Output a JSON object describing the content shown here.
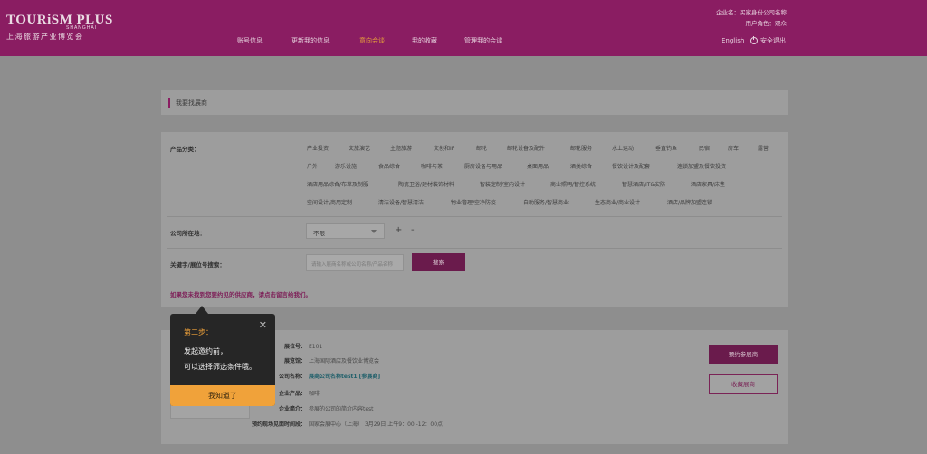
{
  "header": {
    "logo_main": "TOURiSM PLUS",
    "logo_sub": "SHANGHAI",
    "logo_cn": "上海旅游产业博览会",
    "nav": [
      "账号信息",
      "更新我的信息",
      "意向会谈",
      "我的收藏",
      "管理我的会谈"
    ],
    "active_nav": "意向会谈",
    "company_label": "企业名：买家身份公司名称",
    "role_label": "用户角色：观众",
    "lang": "English",
    "logout": "安全退出"
  },
  "page": {
    "title": "我要找展商"
  },
  "filters": {
    "category_label": "产品分类：",
    "categories": [
      [
        "产业投资",
        "文旅演艺",
        "主题旅游",
        "文创和IP",
        "邮轮",
        "邮轮设备及配件",
        "邮轮服务",
        "水上运动",
        "垂直钓鱼",
        "民宿",
        "房车",
        "露营"
      ],
      [
        "户外",
        "游乐设施",
        "食品综合",
        "咖啡与茶",
        "厨房设备与用品",
        "桌面用品",
        "酒类综合",
        "餐饮设计及配套",
        "连锁加盟及餐饮投资"
      ],
      [
        "酒店用品综合/布草及制服",
        "陶瓷卫浴/建材装饰材料",
        "智装定制/室内设计",
        "商业照明/智控系统",
        "智慧酒店/IT&安防",
        "酒店家具/床垫"
      ],
      [
        "空间设计/商用定制",
        "清洁设备/智慧清洁",
        "物业管理/空净防疫",
        "自助服务/智慧商业",
        "生态商业/商业设计",
        "酒店/品牌加盟连锁"
      ]
    ],
    "location_label": "公司所在地：",
    "location_value": "不限",
    "plus": "+",
    "minus": "-",
    "keyword_label": "关键字/展位号搜索：",
    "keyword_placeholder": "请输入展商名称或公司名称/产品名称",
    "search_button": "搜索",
    "notice": "如果您未找到您要约见的供应商，请点击留言给我们。"
  },
  "result": {
    "booth_label": "展位号：",
    "booth_value": "E101",
    "exhibition_label": "展览馆：",
    "exhibition_value": "上海国际酒店及餐饮业博览会",
    "company_label": "公司名称：",
    "company_value": "展商公司名称test1 [参展商]",
    "product_label": "企业产品：",
    "product_value": "咖啡",
    "intro_label": "企业简介：",
    "intro_value": "参展的公司的简介内容test",
    "time_label": "预约现场见面时间段：",
    "time_value": "国家会展中心（上海） 3月29日 上午9：00 -12：00点",
    "book_button": "预约参展商",
    "favorite_button": "收藏展商"
  },
  "tooltip": {
    "title": "第二步：",
    "line1": "发起邀约前，",
    "line2": "可以选择筛选条件哦。",
    "close": "✕",
    "button": "我知道了"
  }
}
